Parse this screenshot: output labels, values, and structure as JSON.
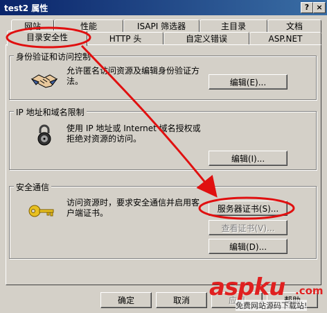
{
  "window": {
    "title": "test2 属性",
    "help_button": "?",
    "close_button": "×"
  },
  "tabs": {
    "row1": [
      "网站",
      "性能",
      "ISAPI 筛选器",
      "主目录",
      "文档"
    ],
    "row2": [
      "目录安全性",
      "HTTP 头",
      "自定义错误",
      "ASP.NET"
    ]
  },
  "auth": {
    "title": "身份验证和访问控制",
    "text1": "允许匿名访问资源及编辑身份验证方",
    "text2": "法。",
    "edit_button": "编辑(E)..."
  },
  "ip": {
    "title": "IP 地址和域名限制",
    "text1": "使用 IP 地址或 Internet 域名授权或",
    "text2": "拒绝对资源的访问。",
    "edit_button": "编辑(I)..."
  },
  "secure": {
    "title": "安全通信",
    "text1": "访问资源时，要求安全通信并启用客",
    "text2": "户端证书。",
    "server_cert_button": "服务器证书(S)...",
    "view_cert_button": "查看证书(V)...",
    "edit_button": "编辑(D)..."
  },
  "footer": {
    "ok": "确定",
    "cancel": "取消",
    "apply": "应用",
    "help": "帮助"
  },
  "watermark": {
    "brand": "aspku",
    "domain": ".com",
    "slogan": "免费网站源码下载站!"
  },
  "colors": {
    "annotation_red": "#e01010",
    "titlebar": "#0a246a",
    "face": "#d4d0c8"
  }
}
